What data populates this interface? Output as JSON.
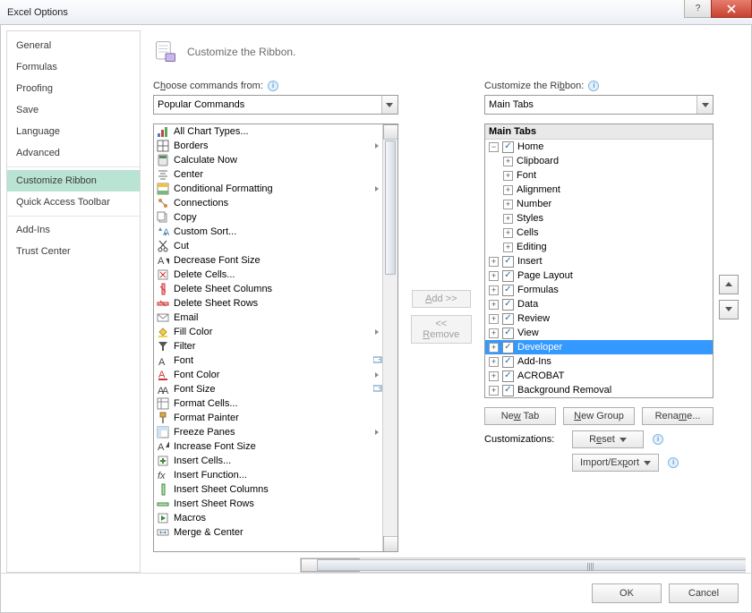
{
  "window": {
    "title": "Excel Options"
  },
  "nav": {
    "groups": [
      [
        "General",
        "Formulas",
        "Proofing",
        "Save",
        "Language",
        "Advanced"
      ],
      [
        "Customize Ribbon",
        "Quick Access Toolbar"
      ],
      [
        "Add-Ins",
        "Trust Center"
      ]
    ],
    "selected": "Customize Ribbon"
  },
  "header": {
    "text": "Customize the Ribbon."
  },
  "left": {
    "label_pre": "C",
    "label_u": "h",
    "label_post": "oose commands from:",
    "combo": "Popular Commands",
    "commands": [
      {
        "name": "All Chart Types...",
        "icon": "chart",
        "sub": false
      },
      {
        "name": "Borders",
        "icon": "borders",
        "sub": true
      },
      {
        "name": "Calculate Now",
        "icon": "calc",
        "sub": false
      },
      {
        "name": "Center",
        "icon": "center",
        "sub": false
      },
      {
        "name": "Conditional Formatting",
        "icon": "condfmt",
        "sub": true
      },
      {
        "name": "Connections",
        "icon": "conn",
        "sub": false
      },
      {
        "name": "Copy",
        "icon": "copy",
        "sub": false
      },
      {
        "name": "Custom Sort...",
        "icon": "sort",
        "sub": false
      },
      {
        "name": "Cut",
        "icon": "cut",
        "sub": false
      },
      {
        "name": "Decrease Font Size",
        "icon": "fontdec",
        "sub": false
      },
      {
        "name": "Delete Cells...",
        "icon": "delcell",
        "sub": false
      },
      {
        "name": "Delete Sheet Columns",
        "icon": "delcol",
        "sub": false
      },
      {
        "name": "Delete Sheet Rows",
        "icon": "delrow",
        "sub": false
      },
      {
        "name": "Email",
        "icon": "email",
        "sub": false
      },
      {
        "name": "Fill Color",
        "icon": "fill",
        "sub": true
      },
      {
        "name": "Filter",
        "icon": "filter",
        "sub": false
      },
      {
        "name": "Font",
        "icon": "font",
        "sub": true,
        "combo": true
      },
      {
        "name": "Font Color",
        "icon": "fontcolor",
        "sub": true
      },
      {
        "name": "Font Size",
        "icon": "fontsize",
        "sub": false,
        "combo": true
      },
      {
        "name": "Format Cells...",
        "icon": "fmtcells",
        "sub": false
      },
      {
        "name": "Format Painter",
        "icon": "painter",
        "sub": false
      },
      {
        "name": "Freeze Panes",
        "icon": "freeze",
        "sub": true
      },
      {
        "name": "Increase Font Size",
        "icon": "fontinc",
        "sub": false
      },
      {
        "name": "Insert Cells...",
        "icon": "inscell",
        "sub": false
      },
      {
        "name": "Insert Function...",
        "icon": "fx",
        "sub": false
      },
      {
        "name": "Insert Sheet Columns",
        "icon": "inscol",
        "sub": false
      },
      {
        "name": "Insert Sheet Rows",
        "icon": "insrow",
        "sub": false
      },
      {
        "name": "Macros",
        "icon": "macros",
        "sub": false
      },
      {
        "name": "Merge & Center",
        "icon": "merge",
        "sub": false
      }
    ]
  },
  "mid": {
    "add": "Add >>",
    "remove": "<< Remove"
  },
  "right": {
    "label": "Customize the Ri",
    "label_u": "b",
    "label_post": "bon:",
    "combo": "Main Tabs",
    "tree_header": "Main Tabs",
    "home": {
      "name": "Home",
      "children": [
        "Clipboard",
        "Font",
        "Alignment",
        "Number",
        "Styles",
        "Cells",
        "Editing"
      ]
    },
    "tabs": [
      "Insert",
      "Page Layout",
      "Formulas",
      "Data",
      "Review",
      "View",
      "Developer",
      "Add-Ins",
      "ACROBAT",
      "Background Removal"
    ],
    "selected": "Developer"
  },
  "buttons": {
    "newtab_pre": "Ne",
    "newtab_u": "w",
    "newtab_post": " Tab",
    "newgroup_pre": "",
    "newgroup_u": "N",
    "newgroup_post": "ew Group",
    "rename_pre": "Rena",
    "rename_u": "m",
    "rename_post": "e...",
    "customizations": "Customizations:",
    "reset": "Reset",
    "import": "Import/Export",
    "ok": "OK",
    "cancel": "Cancel"
  }
}
